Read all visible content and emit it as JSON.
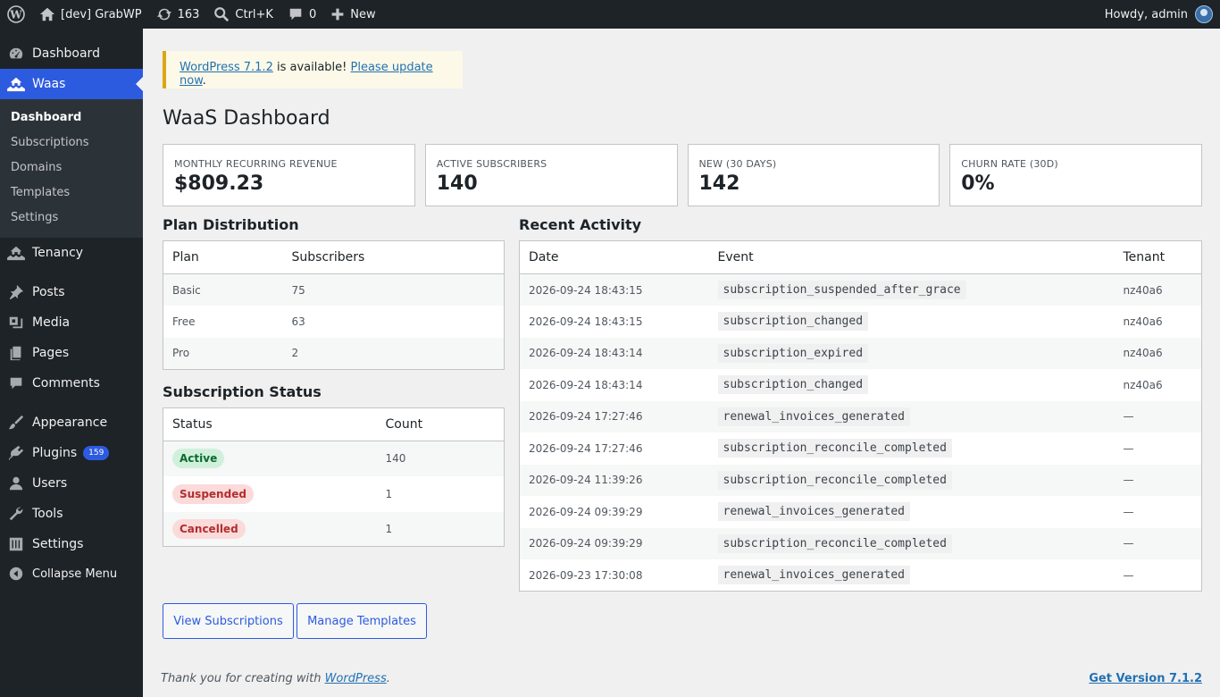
{
  "adminbar": {
    "site_name": "[dev] GrabWP",
    "updates_count": "163",
    "search_shortcut": "Ctrl+K",
    "comments_count": "0",
    "new_label": "New",
    "howdy": "Howdy, admin"
  },
  "sidebar": {
    "dashboard": "Dashboard",
    "waas": "Waas",
    "submenu": [
      "Dashboard",
      "Subscriptions",
      "Domains",
      "Templates",
      "Settings"
    ],
    "tenancy": "Tenancy",
    "posts": "Posts",
    "media": "Media",
    "pages": "Pages",
    "comments": "Comments",
    "appearance": "Appearance",
    "plugins": "Plugins",
    "plugins_badge": "159",
    "users": "Users",
    "tools": "Tools",
    "settings": "Settings",
    "collapse": "Collapse Menu"
  },
  "notice": {
    "link1": "WordPress 7.1.2",
    "text": " is available! ",
    "link2": "Please update now",
    "end": "."
  },
  "page_title": "WaaS Dashboard",
  "stats": [
    {
      "label": "MONTHLY RECURRING REVENUE",
      "value": "$809.23"
    },
    {
      "label": "ACTIVE SUBSCRIBERS",
      "value": "140"
    },
    {
      "label": "NEW (30 DAYS)",
      "value": "142"
    },
    {
      "label": "CHURN RATE (30D)",
      "value": "0%"
    }
  ],
  "plan_distribution": {
    "title": "Plan Distribution",
    "headers": [
      "Plan",
      "Subscribers"
    ],
    "rows": [
      [
        "Basic",
        "75"
      ],
      [
        "Free",
        "63"
      ],
      [
        "Pro",
        "2"
      ]
    ]
  },
  "subscription_status": {
    "title": "Subscription Status",
    "headers": [
      "Status",
      "Count"
    ],
    "rows": [
      [
        "Active",
        "140"
      ],
      [
        "Suspended",
        "1"
      ],
      [
        "Cancelled",
        "1"
      ]
    ]
  },
  "recent_activity": {
    "title": "Recent Activity",
    "headers": [
      "Date",
      "Event",
      "Tenant"
    ],
    "rows": [
      [
        "2026-09-24 18:43:15",
        "subscription_suspended_after_grace",
        "nz40a6"
      ],
      [
        "2026-09-24 18:43:15",
        "subscription_changed",
        "nz40a6"
      ],
      [
        "2026-09-24 18:43:14",
        "subscription_expired",
        "nz40a6"
      ],
      [
        "2026-09-24 18:43:14",
        "subscription_changed",
        "nz40a6"
      ],
      [
        "2026-09-24 17:27:46",
        "renewal_invoices_generated",
        "—"
      ],
      [
        "2026-09-24 17:27:46",
        "subscription_reconcile_completed",
        "—"
      ],
      [
        "2026-09-24 11:39:26",
        "subscription_reconcile_completed",
        "—"
      ],
      [
        "2026-09-24 09:39:29",
        "renewal_invoices_generated",
        "—"
      ],
      [
        "2026-09-24 09:39:29",
        "subscription_reconcile_completed",
        "—"
      ],
      [
        "2026-09-23 17:30:08",
        "renewal_invoices_generated",
        "—"
      ]
    ]
  },
  "buttons": {
    "view_subscriptions": "View Subscriptions",
    "manage_templates": "Manage Templates"
  },
  "footer": {
    "thanks_prefix": "Thank you for creating with ",
    "thanks_link": "WordPress",
    "thanks_suffix": ".",
    "version": "Get Version 7.1.2"
  },
  "colors": {
    "admin_dark": "#1d2327",
    "accent": "#2c5be0",
    "notice_border": "#dba617"
  }
}
